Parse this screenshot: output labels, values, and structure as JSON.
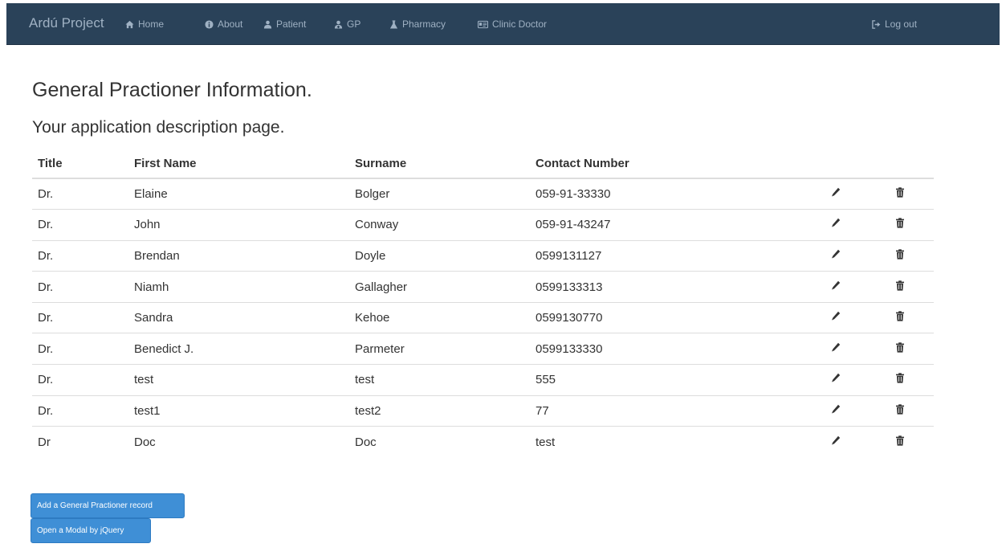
{
  "nav": {
    "brand": "Ardú Project",
    "items": [
      {
        "label": "Home",
        "icon": "home-icon"
      },
      {
        "label": "About",
        "icon": "info-icon"
      },
      {
        "label": "Patient",
        "icon": "user-icon"
      },
      {
        "label": "GP",
        "icon": "doctor-icon"
      },
      {
        "label": "Pharmacy",
        "icon": "flask-icon"
      },
      {
        "label": "Clinic Doctor",
        "icon": "id-card-icon"
      }
    ],
    "logout": "Log out",
    "logout_icon": "logout-icon"
  },
  "page": {
    "title": "General Practioner Information.",
    "subtitle": "Your application description page."
  },
  "table": {
    "headers": [
      "Title",
      "First Name",
      "Surname",
      "Contact Number"
    ],
    "rows": [
      {
        "title": "Dr.",
        "first": "Elaine",
        "surname": "Bolger",
        "contact": "059-91-33330"
      },
      {
        "title": "Dr.",
        "first": "John",
        "surname": "Conway",
        "contact": "059-91-43247"
      },
      {
        "title": "Dr.",
        "first": "Brendan",
        "surname": "Doyle",
        "contact": "0599131127"
      },
      {
        "title": "Dr.",
        "first": "Niamh",
        "surname": "Gallagher",
        "contact": "0599133313"
      },
      {
        "title": "Dr.",
        "first": "Sandra",
        "surname": "Kehoe",
        "contact": "0599130770"
      },
      {
        "title": "Dr.",
        "first": "Benedict J.",
        "surname": "Parmeter",
        "contact": "0599133330"
      },
      {
        "title": "Dr.",
        "first": "test",
        "surname": "test",
        "contact": "555"
      },
      {
        "title": "Dr.",
        "first": "test1",
        "surname": "test2",
        "contact": "77"
      },
      {
        "title": "Dr",
        "first": "Doc",
        "surname": "Doc",
        "contact": "test"
      }
    ]
  },
  "buttons": {
    "add": "Add a General Practioner record",
    "modal": "Open a Modal by jQuery"
  },
  "colors": {
    "navbar": "#2a4259",
    "nav_text": "#9fb1c3",
    "button": "#3f8fd6"
  }
}
